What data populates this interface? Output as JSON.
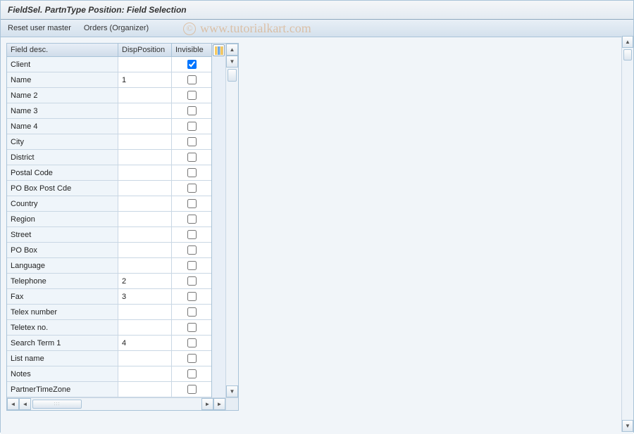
{
  "title": "FieldSel. PartnType Position: Field Selection",
  "toolbar": {
    "reset_label": "Reset user master",
    "orders_label": "Orders (Organizer)"
  },
  "watermark": "www.tutorialkart.com",
  "table": {
    "headers": {
      "field": "Field desc.",
      "disp": "DispPosition",
      "invisible": "Invisible"
    },
    "rows": [
      {
        "field": "Client",
        "disp": "",
        "invisible": true
      },
      {
        "field": "Name",
        "disp": "1",
        "invisible": false
      },
      {
        "field": "Name 2",
        "disp": "",
        "invisible": false
      },
      {
        "field": "Name 3",
        "disp": "",
        "invisible": false
      },
      {
        "field": "Name 4",
        "disp": "",
        "invisible": false
      },
      {
        "field": "City",
        "disp": "",
        "invisible": false
      },
      {
        "field": "District",
        "disp": "",
        "invisible": false
      },
      {
        "field": "Postal Code",
        "disp": "",
        "invisible": false
      },
      {
        "field": "PO Box Post Cde",
        "disp": "",
        "invisible": false
      },
      {
        "field": "Country",
        "disp": "",
        "invisible": false
      },
      {
        "field": "Region",
        "disp": "",
        "invisible": false
      },
      {
        "field": "Street",
        "disp": "",
        "invisible": false
      },
      {
        "field": "PO Box",
        "disp": "",
        "invisible": false
      },
      {
        "field": "Language",
        "disp": "",
        "invisible": false
      },
      {
        "field": "Telephone",
        "disp": "2",
        "invisible": false
      },
      {
        "field": "Fax",
        "disp": "3",
        "invisible": false
      },
      {
        "field": "Telex number",
        "disp": "",
        "invisible": false
      },
      {
        "field": "Teletex no.",
        "disp": "",
        "invisible": false
      },
      {
        "field": "Search Term 1",
        "disp": "4",
        "invisible": false
      },
      {
        "field": "List name",
        "disp": "",
        "invisible": false
      },
      {
        "field": "Notes",
        "disp": "",
        "invisible": false
      },
      {
        "field": "PartnerTimeZone",
        "disp": "",
        "invisible": false
      }
    ]
  }
}
